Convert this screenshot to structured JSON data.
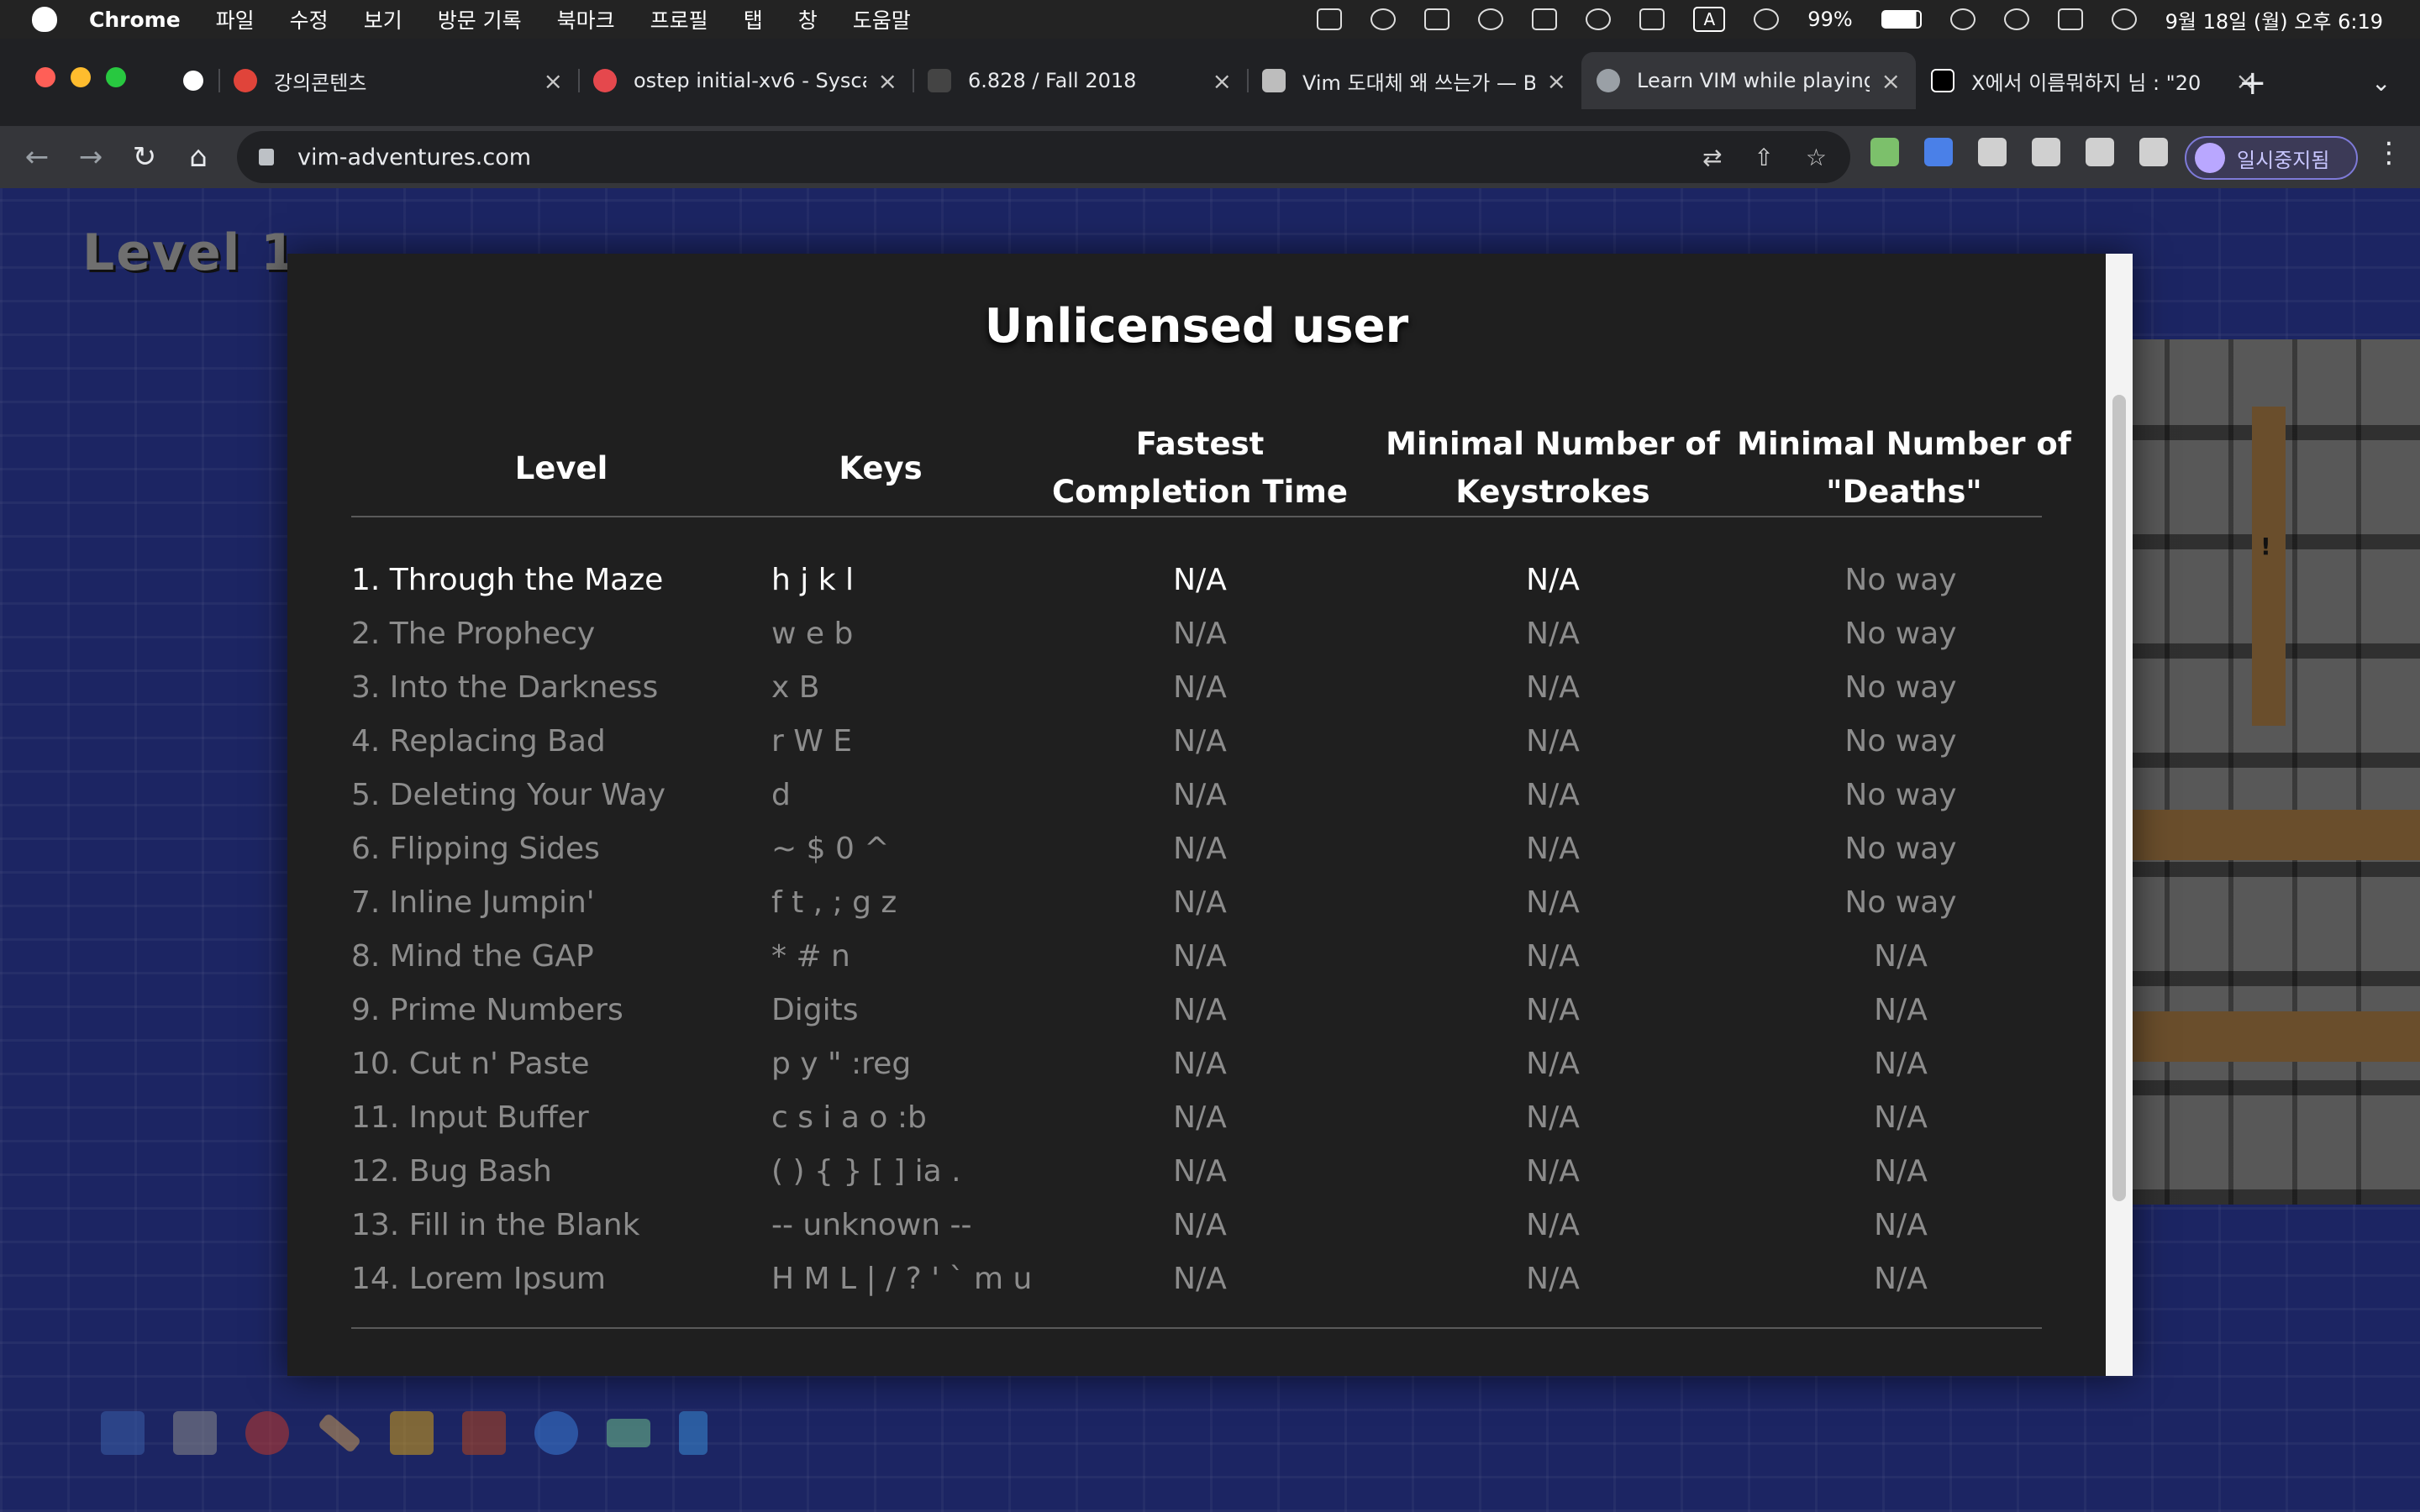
{
  "menubar": {
    "app_name": "Chrome",
    "items": [
      "파일",
      "수정",
      "보기",
      "방문 기록",
      "북마크",
      "프로필",
      "탭",
      "창",
      "도움말"
    ],
    "battery": "99%",
    "input_indicator": "A",
    "datetime": "9월 18일 (월) 오후 6:19"
  },
  "tabs": [
    {
      "title": "",
      "favicon_color": "#ffffff"
    },
    {
      "title": "강의콘텐츠",
      "favicon_color": "#e0443a"
    },
    {
      "title": "ostep initial-xv6 - Sysca",
      "favicon_color": "#e5484d"
    },
    {
      "title": "6.828 / Fall 2018",
      "favicon_color": "#444444"
    },
    {
      "title": "Vim 도대체 왜 쓰는가 — Be",
      "favicon_color": "#bdbdbd"
    },
    {
      "title": "Learn VIM while playing",
      "favicon_color": "#9aa0a6",
      "active": true
    },
    {
      "title": "X에서 이름뭐하지 님 : \"20",
      "favicon_color": "#000000"
    }
  ],
  "toolbar": {
    "url": "vim-adventures.com",
    "profile_label": "일시중지됨"
  },
  "game": {
    "level_label": "Level  1"
  },
  "modal": {
    "title": "Unlicensed user",
    "headers": {
      "level": "Level",
      "keys": "Keys",
      "time_line1": "Fastest",
      "time_line2": "Completion Time",
      "keystrokes_line1": "Minimal Number of",
      "keystrokes_line2": "Keystrokes",
      "deaths_line1": "Minimal Number of",
      "deaths_line2": "\"Deaths\""
    },
    "rows": [
      {
        "level": "1. Through the Maze",
        "keys": "h j k l",
        "time": "N/A",
        "keystrokes": "N/A",
        "deaths": "No way"
      },
      {
        "level": "2. The Prophecy",
        "keys": "w e b",
        "time": "N/A",
        "keystrokes": "N/A",
        "deaths": "No way"
      },
      {
        "level": "3. Into the Darkness",
        "keys": "x B",
        "time": "N/A",
        "keystrokes": "N/A",
        "deaths": "No way"
      },
      {
        "level": "4. Replacing Bad",
        "keys": "r W E",
        "time": "N/A",
        "keystrokes": "N/A",
        "deaths": "No way"
      },
      {
        "level": "5. Deleting Your Way",
        "keys": "d",
        "time": "N/A",
        "keystrokes": "N/A",
        "deaths": "No way"
      },
      {
        "level": "6. Flipping Sides",
        "keys": "~ $ 0 ^",
        "time": "N/A",
        "keystrokes": "N/A",
        "deaths": "No way"
      },
      {
        "level": "7. Inline Jumpin'",
        "keys": "f t , ; g z",
        "time": "N/A",
        "keystrokes": "N/A",
        "deaths": "No way"
      },
      {
        "level": "8. Mind the GAP",
        "keys": "* # n",
        "time": "N/A",
        "keystrokes": "N/A",
        "deaths": "N/A"
      },
      {
        "level": "9. Prime Numbers",
        "keys": "Digits",
        "time": "N/A",
        "keystrokes": "N/A",
        "deaths": "N/A"
      },
      {
        "level": "10. Cut n' Paste",
        "keys": "p y \" :reg",
        "time": "N/A",
        "keystrokes": "N/A",
        "deaths": "N/A"
      },
      {
        "level": "11. Input Buffer",
        "keys": "c s i a o :b",
        "time": "N/A",
        "keystrokes": "N/A",
        "deaths": "N/A"
      },
      {
        "level": "12. Bug Bash",
        "keys": "( ) { } [ ] ia .",
        "time": "N/A",
        "keystrokes": "N/A",
        "deaths": "N/A"
      },
      {
        "level": "13. Fill in the Blank",
        "keys": "-- unknown --",
        "time": "N/A",
        "keystrokes": "N/A",
        "deaths": "N/A"
      },
      {
        "level": "14. Lorem Ipsum",
        "keys": "H M L | / ? ' ` m u",
        "time": "N/A",
        "keystrokes": "N/A",
        "deaths": "N/A"
      }
    ]
  },
  "bottom_icons": [
    {
      "name": "book-icon",
      "color": "#3b5ea8"
    },
    {
      "name": "keyboard-icon",
      "color": "#8a8a8a"
    },
    {
      "name": "character-icon",
      "color": "#c0392b"
    },
    {
      "name": "ruler-icon",
      "color": "#c99a56"
    },
    {
      "name": "puzzle-icon",
      "color": "#d4a017"
    },
    {
      "name": "license-book-icon",
      "color": "#b5461d"
    },
    {
      "name": "help-icon",
      "color": "#3a7bd5"
    },
    {
      "name": "credit-card-icon",
      "color": "#6dbf8a"
    },
    {
      "name": "music-icon",
      "color": "#3a8dd5"
    }
  ]
}
